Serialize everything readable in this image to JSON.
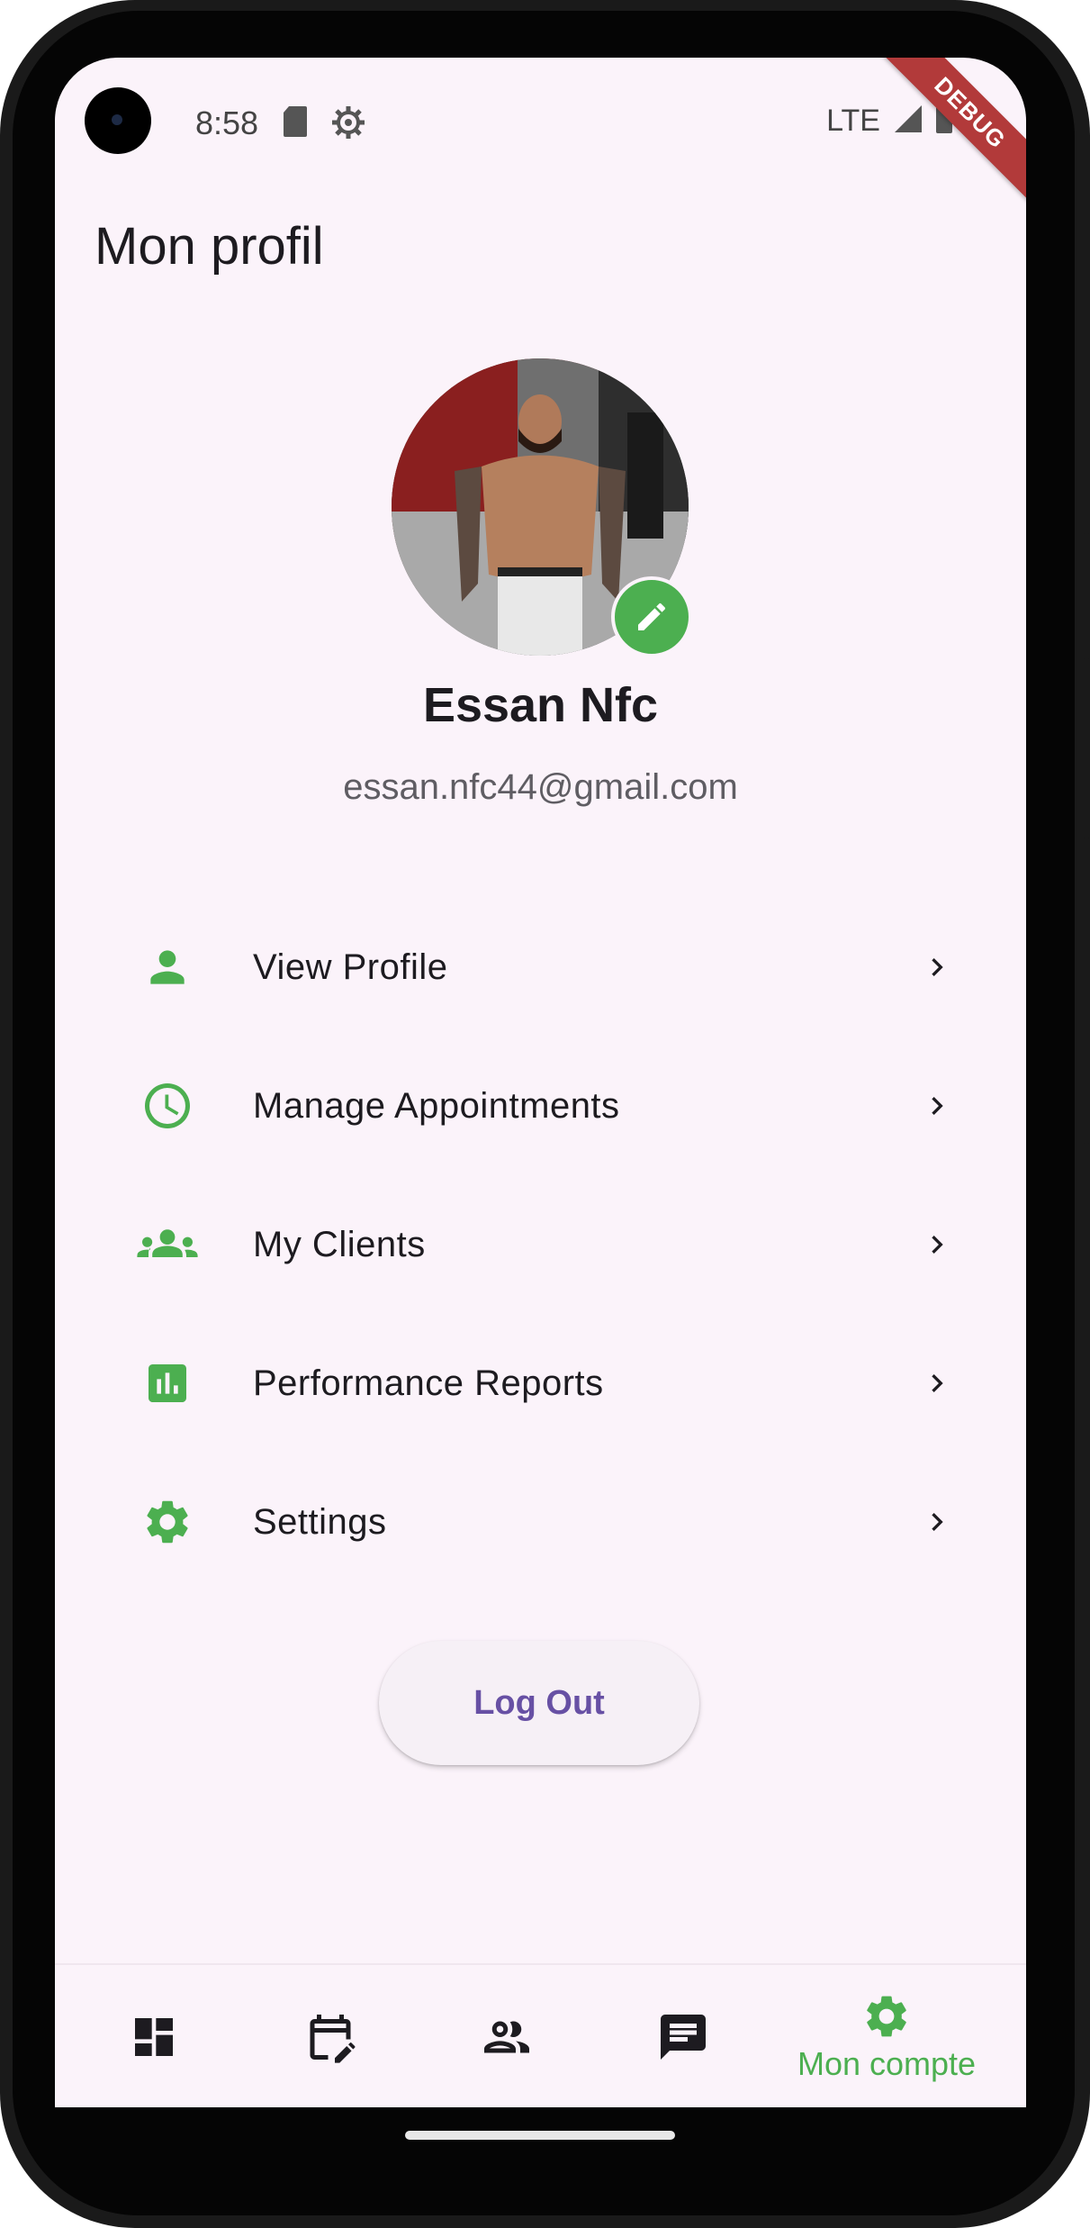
{
  "status_bar": {
    "time": "8:58",
    "network": "LTE",
    "debug_label": "DEBUG"
  },
  "page": {
    "title": "Mon profil"
  },
  "profile": {
    "name": "Essan Nfc",
    "email": "essan.nfc44@gmail.com"
  },
  "menu": {
    "items": [
      {
        "label": "View Profile",
        "icon": "person-icon"
      },
      {
        "label": "Manage Appointments",
        "icon": "clock-icon"
      },
      {
        "label": "My Clients",
        "icon": "group-icon"
      },
      {
        "label": "Performance Reports",
        "icon": "bar-chart-icon"
      },
      {
        "label": "Settings",
        "icon": "gear-icon"
      }
    ]
  },
  "logout": {
    "label": "Log Out"
  },
  "bottom_nav": {
    "items": [
      {
        "icon": "dashboard-icon"
      },
      {
        "icon": "calendar-edit-icon"
      },
      {
        "icon": "people-icon"
      },
      {
        "icon": "chat-icon"
      },
      {
        "icon": "gear-icon",
        "label": "Mon compte",
        "active": true
      }
    ]
  },
  "colors": {
    "accent": "#4caf50",
    "background": "#fbf3fa",
    "button_text": "#6750a4"
  }
}
